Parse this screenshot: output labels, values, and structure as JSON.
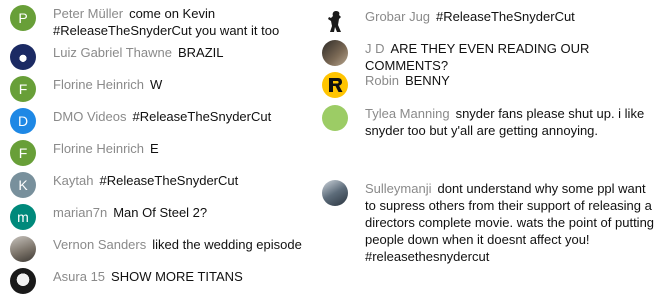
{
  "left_column": [
    {
      "initial": "P",
      "avatar_color": "#689f38",
      "author": "Peter Müller",
      "text": "come on Kevin #ReleaseTheSnyderCut you want it too"
    },
    {
      "initial": "",
      "avatar_color": "#1b2a63",
      "author": "Luiz Gabriel Thawne",
      "text": "BRAZIL"
    },
    {
      "initial": "F",
      "avatar_color": "#689f38",
      "author": "Florine Heinrich",
      "text": "W"
    },
    {
      "initial": "D",
      "avatar_color": "#1e88e5",
      "author": "DMO Videos",
      "text": "#ReleaseTheSnyderCut"
    },
    {
      "initial": "F",
      "avatar_color": "#689f38",
      "author": "Florine Heinrich",
      "text": "E"
    },
    {
      "initial": "K",
      "avatar_color": "#78909c",
      "author": "Kaytah",
      "text": "#ReleaseTheSnyderCut"
    },
    {
      "initial": "m",
      "avatar_color": "#00897b",
      "author": "marian7n",
      "text": "Man Of Steel 2?"
    },
    {
      "initial": "",
      "avatar_color": "#7d756b",
      "author": "Vernon Sanders",
      "text": "liked the wedding episode"
    },
    {
      "initial": "",
      "avatar_color": "#1a1a1a",
      "author": "Asura 15",
      "text": "SHOW MORE TITANS"
    }
  ],
  "right_column": [
    {
      "initial": "",
      "avatar_color": "#ffffff",
      "author": "Grobar Jug",
      "text": "#ReleaseTheSnyderCut"
    },
    {
      "initial": "",
      "avatar_color": "#5a4b3d",
      "author": "J D",
      "text": "ARE THEY EVEN READING OUR COMMENTS?"
    },
    {
      "initial": "",
      "avatar_color": "#ffc400",
      "author": "Robin",
      "text": "BENNY"
    },
    {
      "initial": "",
      "avatar_color": "#9ccc65",
      "author": "Tylea Manning",
      "text": "snyder fans please shut up. i like snyder too but y'all are getting annoying."
    },
    {
      "initial": "",
      "avatar_color": "#5d6c7a",
      "author": "Sulleymanji",
      "text": "dont understand why some ppl want to supress others from their support of releasing a directors complete movie. wats the point of putting people down when it doesnt affect you! #releasethesnydercut"
    }
  ]
}
